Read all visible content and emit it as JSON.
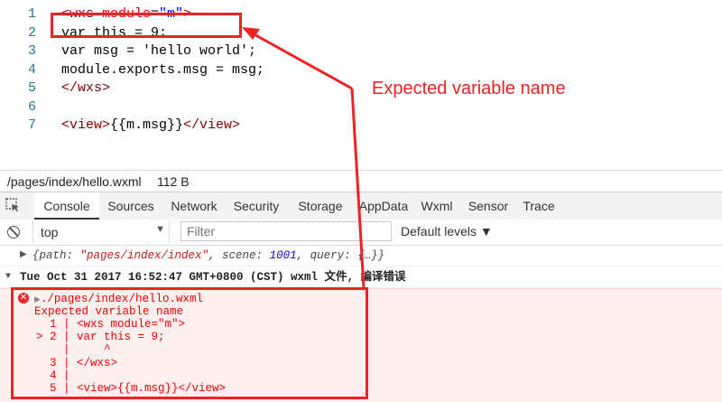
{
  "editor": {
    "lines": [
      {
        "num": "1",
        "parts": [
          [
            "tag",
            "<wxs "
          ],
          [
            "attr",
            "module"
          ],
          [
            "plain",
            "="
          ],
          [
            "str",
            "\"m\""
          ],
          [
            "tag",
            ">"
          ]
        ]
      },
      {
        "num": "2",
        "parts": [
          [
            "plain",
            "var this = 9;"
          ]
        ]
      },
      {
        "num": "3",
        "parts": [
          [
            "plain",
            "var msg = 'hello world';"
          ]
        ]
      },
      {
        "num": "4",
        "parts": [
          [
            "plain",
            "module.exports.msg = msg;"
          ]
        ]
      },
      {
        "num": "5",
        "parts": [
          [
            "tag",
            "</wxs>"
          ]
        ]
      },
      {
        "num": "6",
        "parts": []
      },
      {
        "num": "7",
        "parts": [
          [
            "tag",
            "<view>"
          ],
          [
            "plain",
            "{{m.msg}}"
          ],
          [
            "tag",
            "</view>"
          ]
        ]
      }
    ]
  },
  "file_bar": {
    "path": "/pages/index/hello.wxml",
    "size": "112 B"
  },
  "tabs": [
    {
      "label": "Console",
      "active": true
    },
    {
      "label": "Sources"
    },
    {
      "label": "Network"
    },
    {
      "label": "Security"
    },
    {
      "label": "Storage"
    },
    {
      "label": "AppData"
    },
    {
      "label": "Wxml"
    },
    {
      "label": "Sensor"
    },
    {
      "label": "Trace"
    }
  ],
  "toolbar": {
    "context": "top",
    "filter_placeholder": "Filter",
    "levels": "Default levels ▼"
  },
  "console": {
    "message1": {
      "path_key": "{path: ",
      "path_val": "\"pages/index/index\"",
      "scene_key": ", scene: ",
      "scene_val": "1001",
      "rest": ", query: {…}}"
    },
    "message2": "Tue Oct 31 2017 16:52:47 GMT+0800 (CST) wxml 文件, 编译错误",
    "error": {
      "file": "./pages/index/hello.wxml",
      "title": "Expected variable name",
      "lines": [
        "  1 | <wxs module=\"m\">",
        "> 2 | var this = 9;",
        "    |     ^",
        "  3 | </wxs>",
        "  4 |",
        "  5 | <view>{{m.msg}}</view>"
      ]
    }
  },
  "annotation": {
    "text": "Expected variable name",
    "color": "#e22222"
  }
}
